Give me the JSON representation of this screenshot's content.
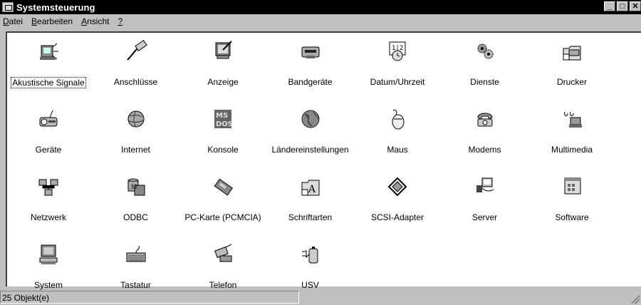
{
  "window": {
    "title": "Systemsteuerung"
  },
  "titlebar_buttons": {
    "minimize": "_",
    "maximize": "□",
    "close": "✕"
  },
  "menu": [
    {
      "label": "Datei",
      "accel": "D"
    },
    {
      "label": "Bearbeiten",
      "accel": "B"
    },
    {
      "label": "Ansicht",
      "accel": "A"
    },
    {
      "label": "?",
      "accel": "?"
    }
  ],
  "items": [
    {
      "label": "Akustische Signale",
      "icon": "sound-icon",
      "selected": true
    },
    {
      "label": "Anschlüsse",
      "icon": "port-cable-icon"
    },
    {
      "label": "Anzeige",
      "icon": "display-icon"
    },
    {
      "label": "Bandgeräte",
      "icon": "tape-drive-icon"
    },
    {
      "label": "Datum/Uhrzeit",
      "icon": "calendar-clock-icon"
    },
    {
      "label": "Dienste",
      "icon": "gears-icon"
    },
    {
      "label": "Drucker",
      "icon": "printer-folder-icon"
    },
    {
      "label": "Geräte",
      "icon": "devices-icon"
    },
    {
      "label": "Internet",
      "icon": "internet-globe-icon"
    },
    {
      "label": "Konsole",
      "icon": "ms-dos-console-icon"
    },
    {
      "label": "Ländereinstellungen",
      "icon": "globe-icon"
    },
    {
      "label": "Maus",
      "icon": "mouse-icon"
    },
    {
      "label": "Modems",
      "icon": "modem-phone-icon"
    },
    {
      "label": "Multimedia",
      "icon": "multimedia-icon"
    },
    {
      "label": "Netzwerk",
      "icon": "network-icon"
    },
    {
      "label": "ODBC",
      "icon": "odbc-database-icon"
    },
    {
      "label": "PC-Karte (PCMCIA)",
      "icon": "pc-card-icon"
    },
    {
      "label": "Schriftarten",
      "icon": "fonts-folder-icon"
    },
    {
      "label": "SCSI-Adapter",
      "icon": "scsi-adapter-icon"
    },
    {
      "label": "Server",
      "icon": "server-icon"
    },
    {
      "label": "Software",
      "icon": "software-icon"
    },
    {
      "label": "System",
      "icon": "computer-icon"
    },
    {
      "label": "Tastatur",
      "icon": "keyboard-icon"
    },
    {
      "label": "Telefon",
      "icon": "telephony-icon"
    },
    {
      "label": "USV",
      "icon": "ups-battery-icon"
    }
  ],
  "status": {
    "text": "25 Objekt(e)"
  }
}
